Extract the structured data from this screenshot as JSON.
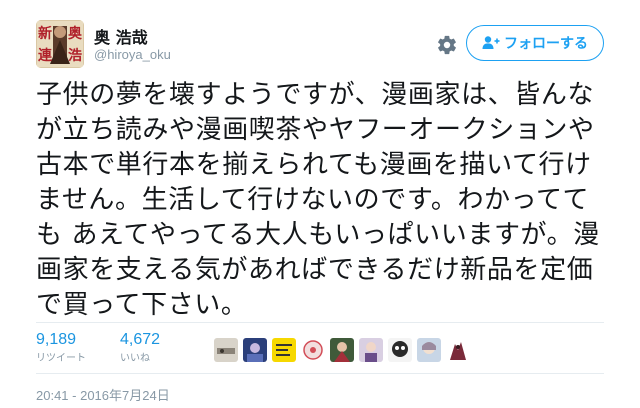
{
  "author": {
    "display_name": "奥 浩哉",
    "handle": "@hiroya_oku",
    "avatar_text": [
      "新",
      "奥",
      "連",
      "浩"
    ]
  },
  "actions": {
    "follow_label": "フォローする",
    "gear_icon": "gear-icon",
    "follow_icon": "person-plus-icon"
  },
  "tweet": {
    "lines": [
      "子供の夢を壊すようですが、漫画家は、皆んな",
      "が立ち読みや漫画喫茶やヤフーオークションや",
      "古本で単行本を揃えられても漫画を描いて行け",
      "ません。生活して行けないのです。わかってて",
      "も あえてやってる大人もいっぱいいますが。漫",
      "画家を支える気があればできるだけ新品を定価",
      "で買って下さい。"
    ]
  },
  "stats": {
    "retweets": {
      "count": "9,189",
      "label": "リツイート"
    },
    "likes": {
      "count": "4,672",
      "label": "いいね"
    }
  },
  "likers": [
    {
      "name": "liker-1",
      "color": "#c9c2b6"
    },
    {
      "name": "liker-2",
      "color": "#3a4e8c"
    },
    {
      "name": "liker-3",
      "color": "#f5d800"
    },
    {
      "name": "liker-4",
      "color": "#e8e8e8"
    },
    {
      "name": "liker-5",
      "color": "#6b4a3a"
    },
    {
      "name": "liker-6",
      "color": "#b9a7c4"
    },
    {
      "name": "liker-7",
      "color": "#2e2e2e"
    },
    {
      "name": "liker-8",
      "color": "#9ab0c8"
    },
    {
      "name": "liker-9",
      "color": "#7a3a4a"
    }
  ],
  "timestamp": "20:41 - 2016年7月24日",
  "colors": {
    "accent": "#1da1f2",
    "stat_number": "#1b95e0",
    "muted": "#8899a6",
    "divider": "#e6ecf0"
  }
}
